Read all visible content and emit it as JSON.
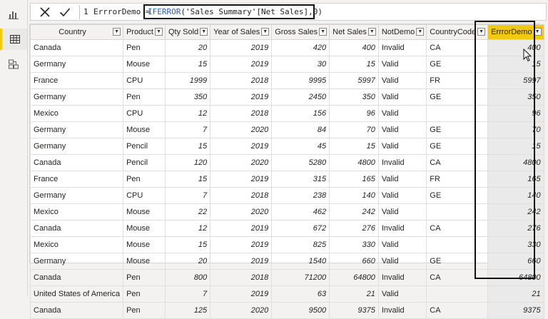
{
  "nav": {
    "icons": [
      "report-view-icon",
      "data-view-icon",
      "model-view-icon"
    ],
    "active": "data-view-icon"
  },
  "formula": {
    "line_number": "1",
    "measure_name": "ErrrorDemo =",
    "function": "IFERROR",
    "expression_rest": "('Sales Summary'[Net Sales],0)"
  },
  "colors": {
    "highlight": "#f2c811",
    "function_text": "#2b5fb3"
  },
  "table": {
    "columns": [
      "Country",
      "Product",
      "Qty Sold",
      "Year of Sales",
      "Gross Sales",
      "Net Sales",
      "NotDemo",
      "CountryCode",
      "ErrrorDemo"
    ],
    "rows": [
      [
        "Canada",
        "Pen",
        "20",
        "2019",
        "420",
        "400",
        "Invalid",
        "CA",
        "400"
      ],
      [
        "Germany",
        "Mouse",
        "15",
        "2019",
        "30",
        "15",
        "Valid",
        "GE",
        "15"
      ],
      [
        "France",
        "CPU",
        "1999",
        "2018",
        "9995",
        "5997",
        "Valid",
        "FR",
        "5997"
      ],
      [
        "Germany",
        "Pen",
        "350",
        "2019",
        "2450",
        "350",
        "Valid",
        "GE",
        "350"
      ],
      [
        "Mexico",
        "CPU",
        "12",
        "2018",
        "156",
        "96",
        "Valid",
        "",
        "96"
      ],
      [
        "Germany",
        "Mouse",
        "7",
        "2020",
        "84",
        "70",
        "Valid",
        "GE",
        "70"
      ],
      [
        "Germany",
        "Pencil",
        "15",
        "2019",
        "45",
        "15",
        "Valid",
        "GE",
        "15"
      ],
      [
        "Canada",
        "Pencil",
        "120",
        "2020",
        "5280",
        "4800",
        "Invalid",
        "CA",
        "4800"
      ],
      [
        "France",
        "Pen",
        "15",
        "2019",
        "315",
        "165",
        "Valid",
        "FR",
        "165"
      ],
      [
        "Germany",
        "CPU",
        "7",
        "2018",
        "238",
        "140",
        "Valid",
        "GE",
        "140"
      ],
      [
        "Mexico",
        "Mouse",
        "22",
        "2020",
        "462",
        "242",
        "Valid",
        "",
        "242"
      ],
      [
        "Canada",
        "Mouse",
        "12",
        "2019",
        "672",
        "276",
        "Invalid",
        "CA",
        "276"
      ],
      [
        "Mexico",
        "Mouse",
        "15",
        "2019",
        "825",
        "330",
        "Valid",
        "",
        "330"
      ],
      [
        "Germany",
        "Mouse",
        "20",
        "2019",
        "1540",
        "660",
        "Valid",
        "GE",
        "660"
      ],
      [
        "Canada",
        "Pen",
        "800",
        "2018",
        "71200",
        "64800",
        "Invalid",
        "CA",
        "64800"
      ],
      [
        "United States of America",
        "Pen",
        "7",
        "2019",
        "63",
        "21",
        "Valid",
        "",
        "21"
      ],
      [
        "Canada",
        "Pen",
        "125",
        "2020",
        "9500",
        "9375",
        "Invalid",
        "CA",
        "9375"
      ]
    ]
  }
}
